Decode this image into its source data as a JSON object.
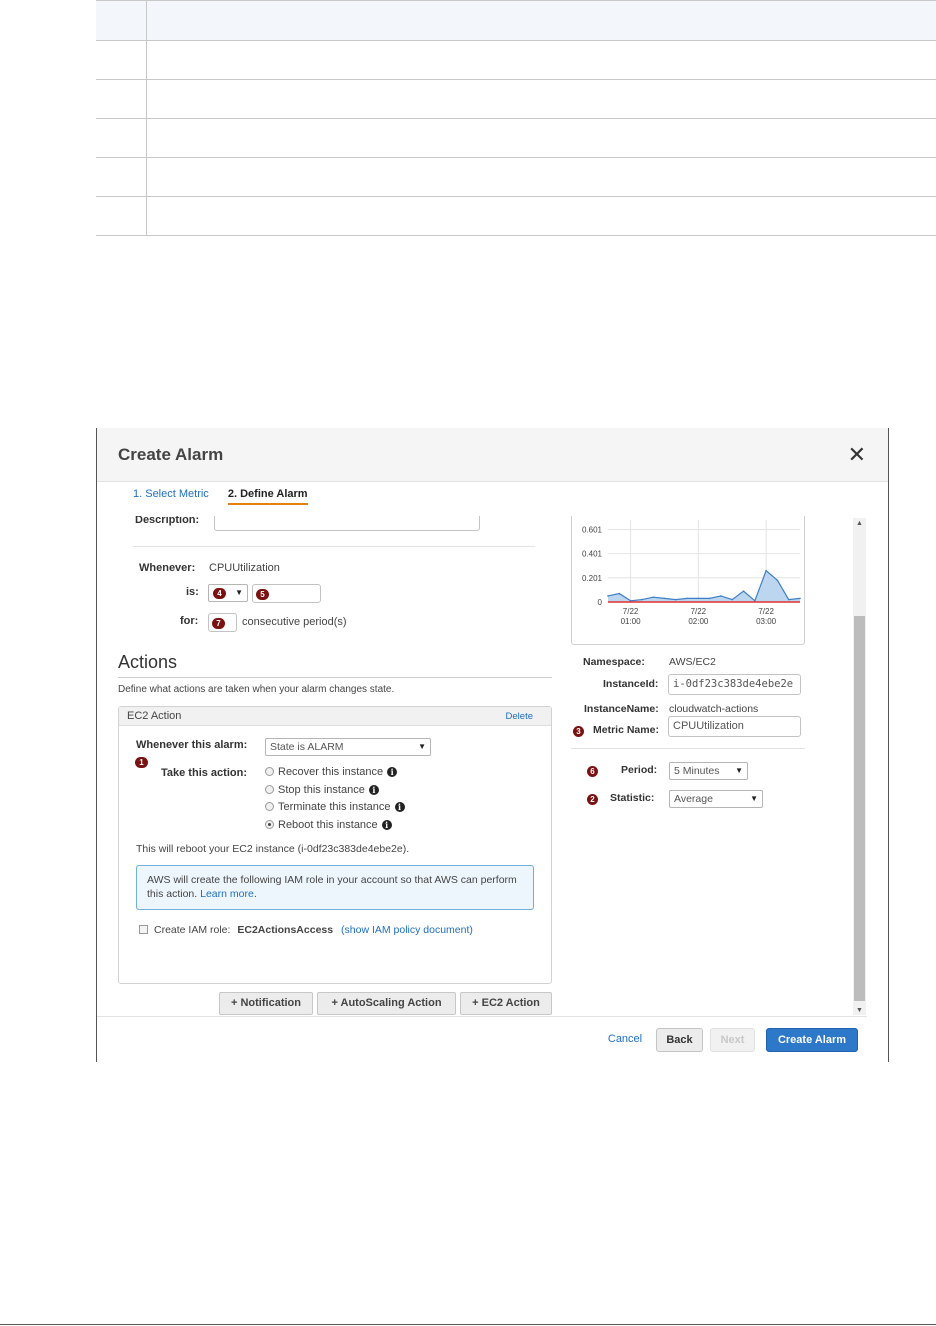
{
  "dialog": {
    "title": "Create Alarm",
    "close_glyph": "✕",
    "steps": [
      "1. Select Metric",
      "2. Define Alarm"
    ]
  },
  "alarm_threshold": {
    "description_label": "Description:",
    "description_value": "",
    "whenever_label": "Whenever:",
    "whenever_value": "CPUUtilization",
    "is_label": "is:",
    "is_badge_operator": "4",
    "is_badge_value": "5",
    "for_label": "for:",
    "for_badge": "7",
    "for_suffix": "consecutive period(s)"
  },
  "actions": {
    "heading": "Actions",
    "description": "Define what actions are taken when your alarm changes state.",
    "panel_title": "EC2 Action",
    "delete_label": "Delete",
    "whenever_alarm_label": "Whenever this alarm:",
    "whenever_alarm_value": "State is ALARM",
    "badge_1": "1",
    "take_action_label": "Take this action:",
    "options": [
      {
        "label": "Recover this instance",
        "selected": false
      },
      {
        "label": "Stop this instance",
        "selected": false
      },
      {
        "label": "Terminate this instance",
        "selected": false
      },
      {
        "label": "Reboot this instance",
        "selected": true
      }
    ],
    "reboot_note": "This will reboot your EC2 instance (i-0df23c383de4ebe2e).",
    "iam_info_text": "AWS will create the following IAM role in your account so that AWS can perform this action.",
    "iam_learn_more": "Learn more",
    "iam_learn_more_suffix": ".",
    "create_iam_label": "Create IAM role:",
    "iam_role_name": "EC2ActionsAccess",
    "iam_policy_link": "(show IAM policy document)",
    "buttons": {
      "notification": "+ Notification",
      "autoscaling": "+ AutoScaling Action",
      "ec2": "+ EC2 Action"
    }
  },
  "metric": {
    "namespace_label": "Namespace:",
    "namespace_value": "AWS/EC2",
    "instance_id_label": "InstanceId:",
    "instance_id_value": "i-0df23c383de4ebe2e",
    "instance_name_label": "InstanceName:",
    "instance_name_value": "cloudwatch-actions",
    "badge_3": "3",
    "metric_name_label": "Metric Name:",
    "metric_name_value": "CPUUtilization",
    "badge_6": "6",
    "period_label": "Period:",
    "period_value": "5 Minutes",
    "badge_2": "2",
    "statistic_label": "Statistic:",
    "statistic_value": "Average"
  },
  "chart_data": {
    "type": "area",
    "title": "",
    "xlabel": "",
    "ylabel": "",
    "y_ticks": [
      "0.601",
      "0.401",
      "0.201",
      "0"
    ],
    "x_ticks": [
      {
        "date": "7/22",
        "time": "01:00"
      },
      {
        "date": "7/22",
        "time": "02:00"
      },
      {
        "date": "7/22",
        "time": "03:00"
      }
    ],
    "ylim": [
      0,
      0.68
    ],
    "x": [
      "00:40",
      "00:50",
      "01:00",
      "01:10",
      "01:20",
      "01:30",
      "01:40",
      "01:50",
      "02:00",
      "02:10",
      "02:20",
      "02:30",
      "02:40",
      "02:50",
      "03:00",
      "03:10",
      "03:20",
      "03:30"
    ],
    "series": [
      {
        "values": [
          0.05,
          0.07,
          0.01,
          0.02,
          0.04,
          0.03,
          0.02,
          0.03,
          0.03,
          0.03,
          0.05,
          0.02,
          0.09,
          0.01,
          0.26,
          0.18,
          0.02,
          0.03
        ]
      }
    ],
    "threshold": 0,
    "colors": {
      "line": "#3f7fc6",
      "fill": "#bcd6f0",
      "threshold": "#e33131"
    }
  },
  "footer": {
    "cancel": "Cancel",
    "back": "Back",
    "next": "Next",
    "create": "Create Alarm"
  },
  "icons": {
    "info": "i",
    "dropdown_arrow": "▼",
    "scroll_up": "▲",
    "scroll_down": "▼"
  }
}
